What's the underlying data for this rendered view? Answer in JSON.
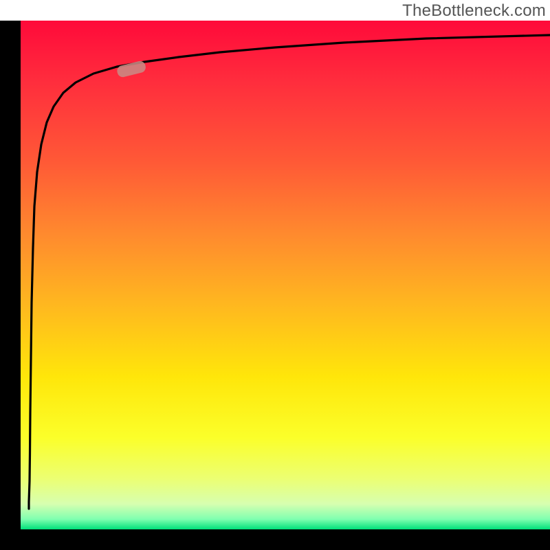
{
  "watermark": "TheBottleneck.com",
  "colors": {
    "axis": "#000000",
    "curve": "#000000",
    "marker_fill": "#c98a84",
    "marker_stroke": "#c98a84",
    "gradient_top": "#ff0a3a",
    "gradient_bottom": "#00e07a"
  },
  "chart_data": {
    "type": "line",
    "title": "",
    "xlabel": "",
    "ylabel": "",
    "xlim": [
      0,
      100
    ],
    "ylim": [
      0,
      100
    ],
    "grid": false,
    "legend": false,
    "annotations": [
      "TheBottleneck.com"
    ],
    "series": [
      {
        "name": "bottleneck-curve",
        "x": [
          0.5,
          1.0,
          1.5,
          2.0,
          2.5,
          3.0,
          3.5,
          4.0,
          5.0,
          6.0,
          8.0,
          10.0,
          13.0,
          16.0,
          20.0,
          25.0,
          30.0,
          40.0,
          50.0,
          60.0,
          75.0,
          90.0,
          100.0
        ],
        "y": [
          4.0,
          8.0,
          20.0,
          40.0,
          55.0,
          65.0,
          71.0,
          75.5,
          80.5,
          83.5,
          86.5,
          88.0,
          89.5,
          90.5,
          91.3,
          92.1,
          92.8,
          93.8,
          94.5,
          95.0,
          95.6,
          96.0,
          96.3
        ]
      }
    ],
    "marker": {
      "series": "bottleneck-curve",
      "x": 20.0,
      "y": 88.5,
      "shape": "rounded-bar"
    }
  }
}
